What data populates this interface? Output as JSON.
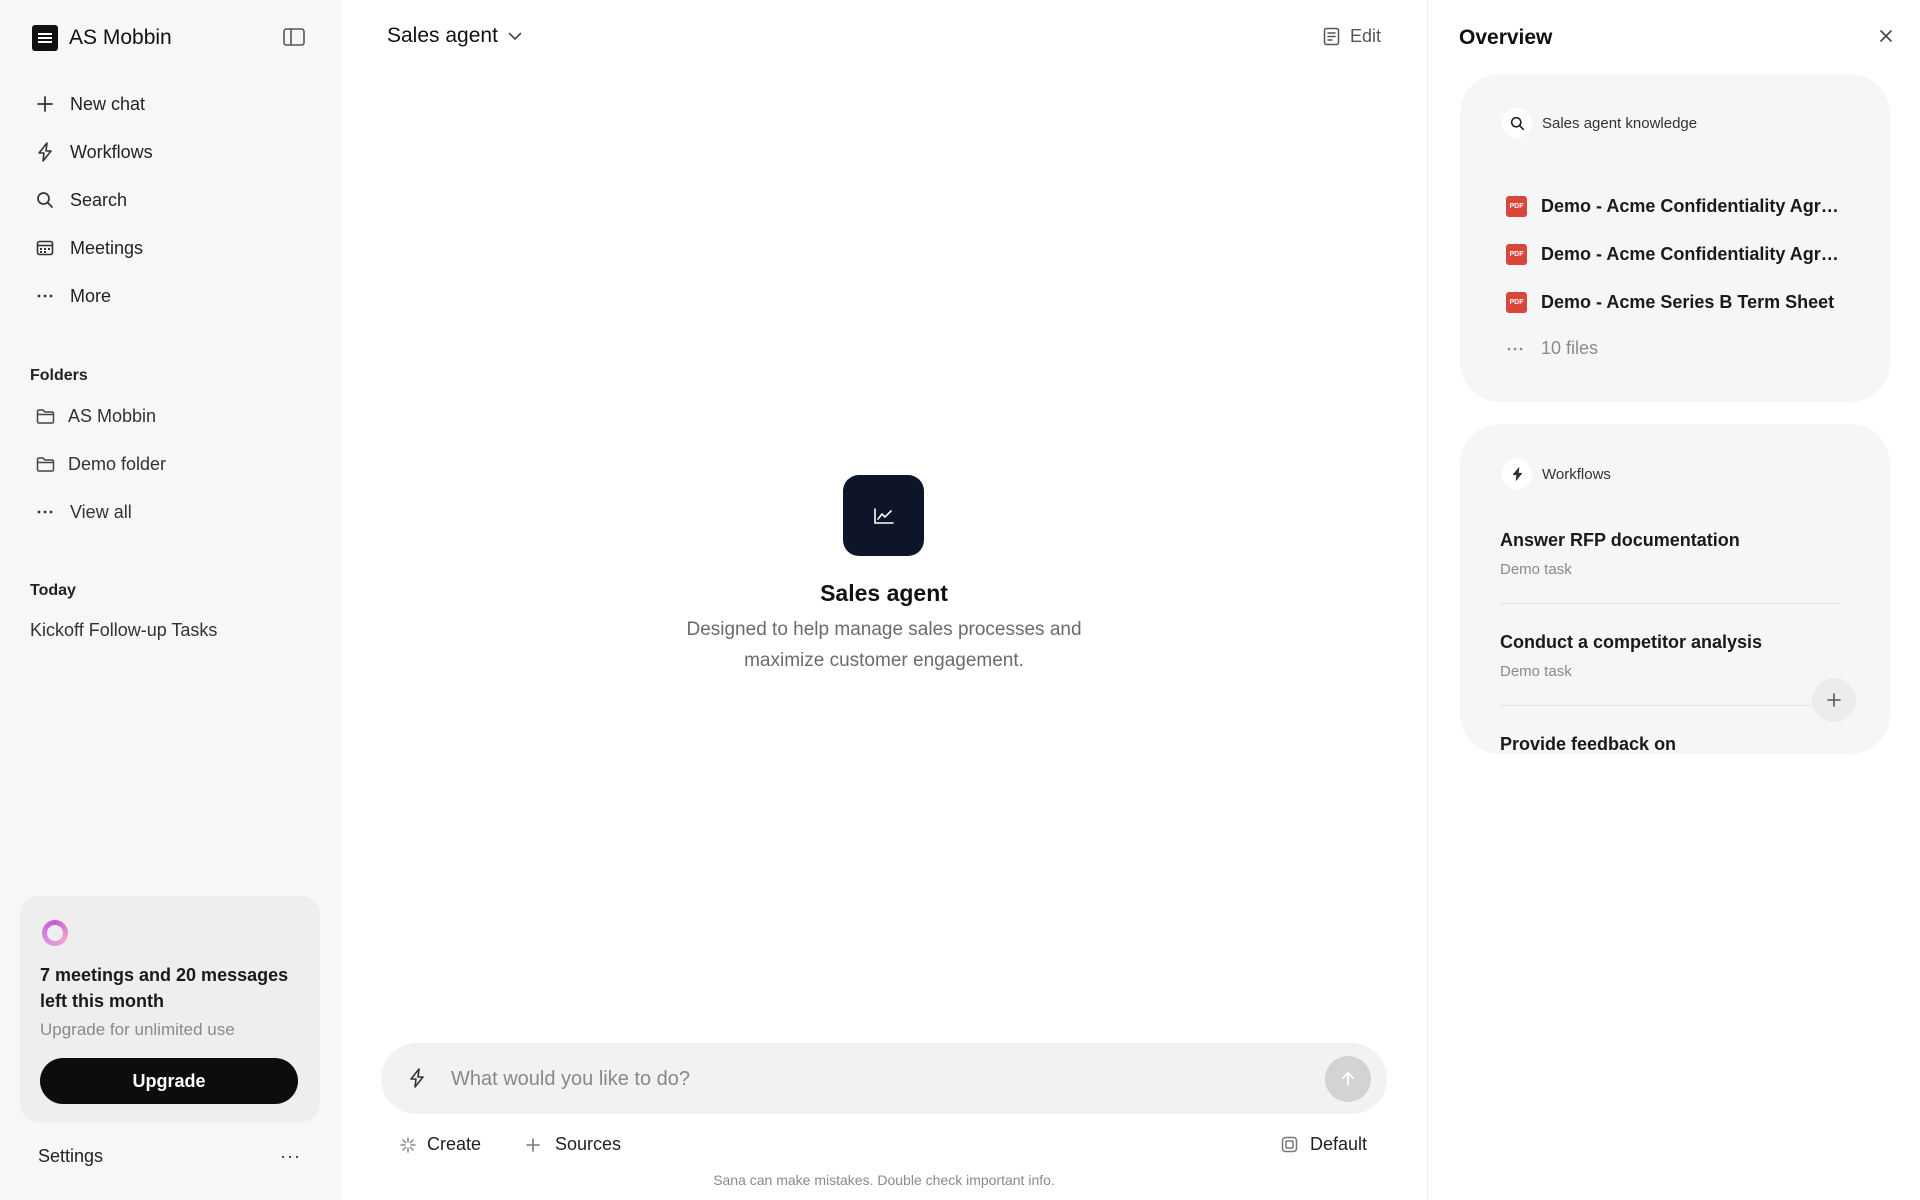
{
  "sidebar": {
    "brand": "AS Mobbin",
    "nav": [
      {
        "label": "New chat",
        "icon": "plus-icon"
      },
      {
        "label": "Workflows",
        "icon": "bolt-icon"
      },
      {
        "label": "Search",
        "icon": "search-icon"
      },
      {
        "label": "Meetings",
        "icon": "calendar-icon"
      },
      {
        "label": "More",
        "icon": "ellipsis-icon"
      }
    ],
    "folders_title": "Folders",
    "folders": [
      {
        "label": "AS Mobbin",
        "icon": "folder-icon"
      },
      {
        "label": "Demo folder",
        "icon": "folder-icon"
      },
      {
        "label": "View all",
        "icon": "ellipsis-icon"
      }
    ],
    "today_title": "Today",
    "today_items": [
      "Kickoff Follow-up Tasks"
    ],
    "upgrade": {
      "message": "7 meetings and 20 messages left this month",
      "sub": "Upgrade for unlimited use",
      "button": "Upgrade"
    },
    "settings": "Settings",
    "settings_more": "···"
  },
  "main": {
    "agent": "Sales agent",
    "edit": "Edit",
    "hero": {
      "title": "Sales agent",
      "description": "Designed to help manage sales processes and maximize customer engagement."
    },
    "composer": {
      "placeholder": "What would you like to do?"
    },
    "tools": {
      "create": "Create",
      "sources": "Sources",
      "model": "Default"
    },
    "disclaimer": "Sana can make mistakes. Double check important info."
  },
  "overview": {
    "title": "Overview",
    "knowledge": {
      "header": "Sales agent knowledge",
      "files": [
        "Demo - Acme Confidentiality Agree...",
        "Demo - Acme Confidentiality Agree...",
        "Demo - Acme Series B Term Sheet"
      ],
      "file_badge": "PDF",
      "more": "10 files"
    },
    "workflows": {
      "header": "Workflows",
      "items": [
        {
          "title": "Answer RFP documentation",
          "subtitle": "Demo task"
        },
        {
          "title": "Conduct a competitor analysis",
          "subtitle": "Demo task"
        },
        {
          "title": "Provide feedback on",
          "subtitle": ""
        }
      ]
    }
  }
}
